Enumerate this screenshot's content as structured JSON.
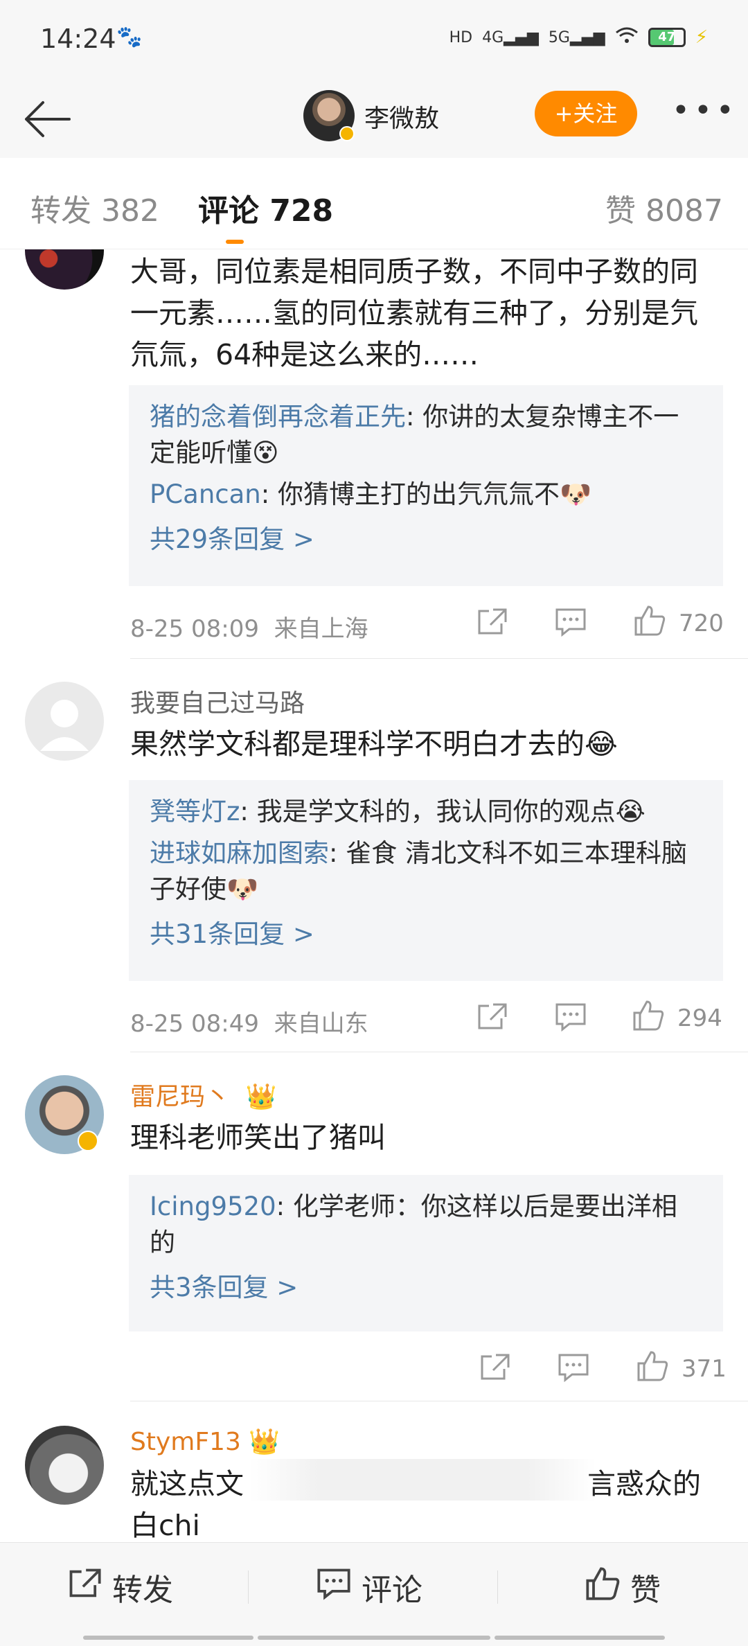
{
  "status": {
    "time": "14:24",
    "battery": "47"
  },
  "header": {
    "author": "李微敖",
    "follow_label": "+关注",
    "more": "•••"
  },
  "tabs": {
    "repost": "转发 382",
    "comment": "评论 728",
    "like": "赞 8087"
  },
  "comments": [
    {
      "text": "大哥，同位素是相同质子数，不同中子数的同一元素……氢的同位素就有三种了，分别是氕氘氚，64种是这么来的……",
      "replies": [
        {
          "user": "猪的念着倒再念着正先",
          "text": ": 你讲的太复杂博主不一定能听懂😵"
        },
        {
          "user": "PCancan",
          "text": ": 你猜博主打的出氕氘氚不🐶"
        }
      ],
      "more": "共29条回复 >",
      "time": "8-25 08:09",
      "location": "来自上海",
      "likes": "720"
    },
    {
      "name": "我要自己过马路",
      "text": "果然学文科都是理科学不明白才去的😂",
      "replies": [
        {
          "user": "凳等灯z",
          "text": ": 我是学文科的，我认同你的观点😭"
        },
        {
          "user": "进球如麻加图索",
          "text": ": 雀食 清北文科不如三本理科脑子好使🐶"
        }
      ],
      "more": "共31条回复 >",
      "time": "8-25 08:49",
      "location": "来自山东",
      "likes": "294"
    },
    {
      "name": "雷尼玛丶",
      "text": "理科老师笑出了猪叫",
      "replies": [
        {
          "user": "Icing9520",
          "text": ": 化学老师：你这样以后是要出洋相的"
        }
      ],
      "more": "共3条回复 >",
      "likes": "371"
    },
    {
      "name": "StymF13",
      "text_a": "就这点文",
      "text_b": "言惑众的",
      "text_c": "白chi"
    }
  ],
  "bottom": {
    "repost": "转发",
    "comment": "评论",
    "like": "赞"
  },
  "colors": {
    "accent": "#ff8a00",
    "link": "#4c7ba8",
    "vip": "#e07a1e"
  }
}
